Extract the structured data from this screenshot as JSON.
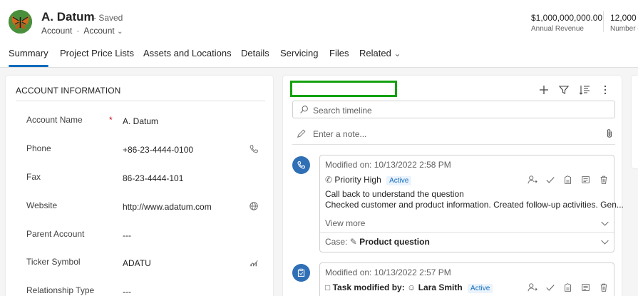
{
  "header": {
    "title": "A. Datum",
    "saved": "- Saved",
    "entity": "Account",
    "form_selector": "Account",
    "metrics": [
      {
        "value": "$1,000,000,000.00",
        "label": "Annual Revenue"
      },
      {
        "value": "12,000",
        "label": "Number o"
      }
    ]
  },
  "tabs": [
    "Summary",
    "Project Price Lists",
    "Assets and Locations",
    "Details",
    "Servicing",
    "Files",
    "Related"
  ],
  "account_info": {
    "title": "ACCOUNT INFORMATION",
    "fields": [
      {
        "label": "Account Name",
        "value": "A. Datum",
        "required": "*"
      },
      {
        "label": "Phone",
        "value": "+86-23-4444-0100"
      },
      {
        "label": "Fax",
        "value": "86-23-4444-101"
      },
      {
        "label": "Website",
        "value": "http://www.adatum.com"
      },
      {
        "label": "Parent Account",
        "value": "---"
      },
      {
        "label": "Ticker Symbol",
        "value": "ADATU"
      },
      {
        "label": "Relationship Type",
        "value": "---"
      }
    ]
  },
  "timeline": {
    "search_placeholder": "Search timeline",
    "note_placeholder": "Enter a note...",
    "items": [
      {
        "modified": "Modified on: 10/13/2022 2:58 PM",
        "subject": "Priority High",
        "status": "Active",
        "line1": "Call back to understand the question",
        "line2": "Checked customer and product information. Created follow-up activities. Gen...",
        "view_more": "View more",
        "case_label": "Case:",
        "case_value": "Product question"
      },
      {
        "modified": "Modified on: 10/13/2022 2:57 PM",
        "task_label": "Task modified by:",
        "user": "Lara Smith",
        "status": "Active"
      }
    ]
  },
  "colors": {
    "accent": "#0f6cbd",
    "highlight_box": "#13a10e",
    "bubble": "#2f6fb5"
  }
}
